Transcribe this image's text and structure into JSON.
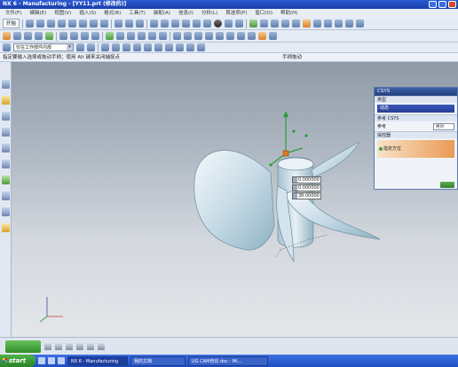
{
  "window": {
    "title": "NX 6 - Manufacturing - [YY11.prt (修改的)]"
  },
  "menubar": {
    "items": [
      "文件(F)",
      "编辑(E)",
      "视图(V)",
      "插入(S)",
      "格式(R)",
      "工具(T)",
      "装配(A)",
      "信息(I)",
      "分析(L)",
      "首选项(P)",
      "窗口(O)",
      "帮助(H)"
    ]
  },
  "toolbar": {
    "start_label": "开始",
    "filter_value": "仅在工作部件内部"
  },
  "cue_line": {
    "prompt": "指定要输入选择或拖动手柄；使用 Alt 键来关闭捕捉点",
    "status": "手柄拖动"
  },
  "coords": {
    "x": "0.000000",
    "y": "0.000000",
    "z": "38.00000"
  },
  "csys_dialog": {
    "title": "CSYS",
    "type_section": "类型",
    "type_value": "动态",
    "reference_section": "参考 CSYS",
    "reference_label": "参考",
    "reference_value": "绝对",
    "manipulator_section": "操控器",
    "orient_label": "指定方位"
  },
  "taskbar": {
    "start": "start",
    "tasks": [
      "NX 6 - Manufacturing",
      "我的文档",
      "UG CAM培训.doc - Mi..."
    ]
  }
}
